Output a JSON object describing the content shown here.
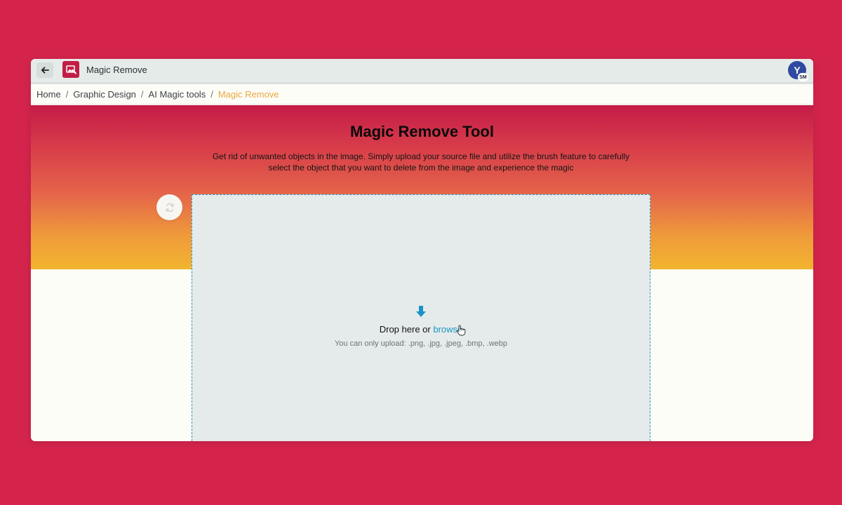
{
  "window": {
    "title": "Magic Remove"
  },
  "avatar": {
    "letter": "Y",
    "badge": "SM"
  },
  "breadcrumb": {
    "items": [
      "Home",
      "Graphic Design",
      "AI Magic tools"
    ],
    "current": "Magic Remove",
    "separator": "/"
  },
  "hero": {
    "title": "Magic Remove Tool",
    "description": "Get rid of unwanted objects in the image. Simply upload your source file and utilize the brush feature to carefully select the object that you want to delete from the image and experience the magic"
  },
  "dropzone": {
    "prompt": "Drop here or ",
    "browse_label": "browse",
    "hint": "You can only upload: .png, .jpg, .jpeg, .bmp, .webp"
  },
  "colors": {
    "background": "#d4244c",
    "accent": "#1a93c6",
    "breadcrumb_current": "#e9a83d",
    "gradient_top": "#c41b48",
    "gradient_bottom": "#f2b530"
  },
  "icons": [
    "arrow-left-icon",
    "magic-remove-app-icon",
    "refresh-icon",
    "download-arrow-icon",
    "hand-cursor-icon"
  ]
}
